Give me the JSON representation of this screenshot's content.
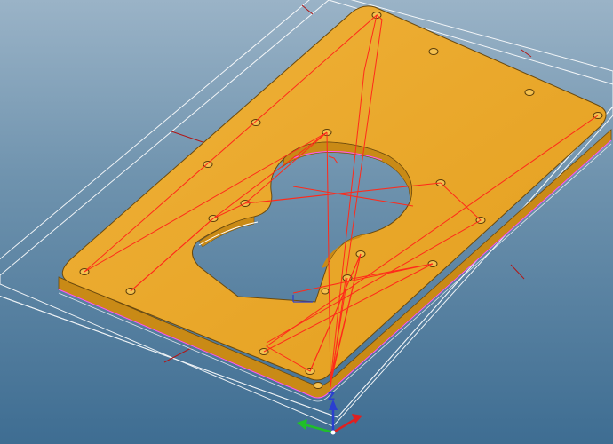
{
  "viewport": {
    "background_top": "#9ab3c7",
    "background_bottom": "#3e6d92"
  },
  "part": {
    "material_color": "#e8a623",
    "edge_color": "#7a5410",
    "hole_count": 20,
    "description_icon": "cam-plate-part"
  },
  "toolpath": {
    "color": "#ff2a1a"
  },
  "stock_outline": {
    "color": "#ffffff"
  },
  "triad": {
    "z_label": "Z",
    "x_color": "#e02020",
    "y_color": "#1fbf2a",
    "z_color": "#2a3fd0"
  }
}
